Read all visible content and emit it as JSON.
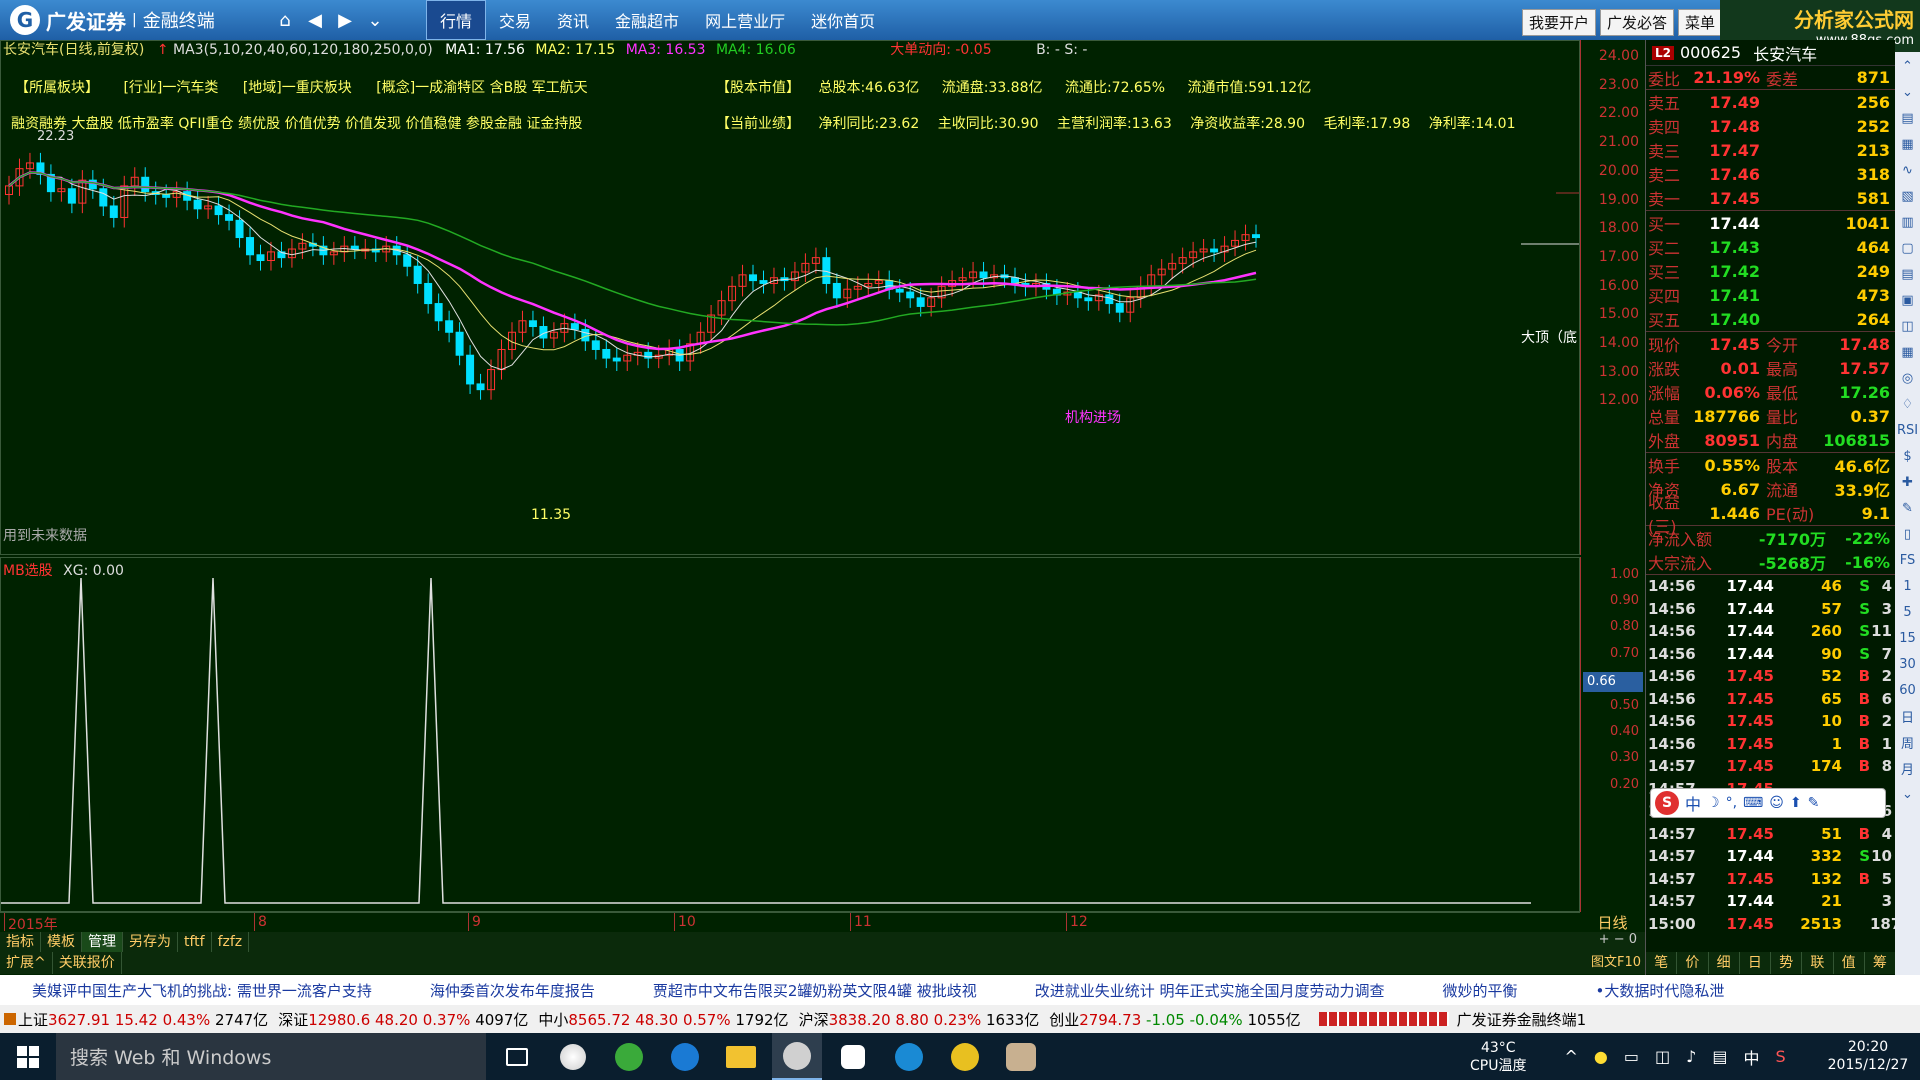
{
  "app": {
    "logo_text": "广发证券",
    "logo_sub": "金融终端",
    "menu": [
      "行情",
      "交易",
      "资讯",
      "金融超市",
      "网上营业厅",
      "迷你首页"
    ],
    "menu_active": 0,
    "right_buttons": [
      "我要开户",
      "广发必答",
      "菜单"
    ],
    "brand_title": "分析家公式网",
    "brand_url": "www.88gs.com"
  },
  "chart": {
    "title": "长安汽车(日线,前复权)",
    "ma_label": "MA3(5,10,20,40,60,120,180,250,0,0)",
    "ma1": "MA1: 17.56",
    "ma2": "MA2: 17.15",
    "ma3": "MA3: 16.53",
    "ma4": "MA4: 16.06",
    "dadan": "大单动向: -0.05",
    "bs": "B: -   S: -",
    "info_row1": [
      "【所属板块】",
      "[行业]一汽车类",
      "[地域]一重庆板块",
      "[概念]一成渝特区 含B股 军工航天"
    ],
    "info_right1": [
      "【股本市值】",
      "总股本:46.63亿",
      "流通盘:33.88亿",
      "流通比:72.65%",
      "流通市值:591.12亿"
    ],
    "info_row2": "融资融券 大盘股 低市盈率 QFII重仓 绩优股 价值优势 价值发现 价值稳健 参股金融 证金持股",
    "info_right2": [
      "【当前业绩】",
      "净利同比:23.62",
      "主收同比:30.90",
      "主营利润率:13.63",
      "净资收益率:28.90",
      "毛利率:17.98",
      "净利率:14.01"
    ],
    "future_note": "用到未来数据",
    "high_label": "22.23",
    "low_label": "11.35",
    "lowpt_label": "机构进场",
    "dading_label": "大顶（底",
    "price_ticks": [
      "24.00",
      "23.00",
      "22.00",
      "21.00",
      "20.00",
      "19.00",
      "18.00",
      "17.00",
      "16.00",
      "15.00",
      "14.00",
      "13.00",
      "12.00"
    ]
  },
  "indicator": {
    "name": "MB选股",
    "value": "XG: 0.00",
    "ticks": [
      "1.00",
      "0.90",
      "0.80",
      "0.70",
      "0.60",
      "0.50",
      "0.40",
      "0.30",
      "0.20"
    ],
    "xg_value": "0.66",
    "spikes_x": [
      80,
      212,
      430
    ]
  },
  "dates": [
    {
      "label": "2015年"
    },
    {
      "label": "8"
    },
    {
      "label": "9"
    },
    {
      "label": "10"
    },
    {
      "label": "11"
    },
    {
      "label": "12"
    }
  ],
  "period": "日线",
  "tabs1": [
    "指标",
    "模板",
    "管理",
    "另存为",
    "tftf",
    "fzfz"
  ],
  "tabs1_active": 2,
  "tabs2": [
    "扩展^",
    "关联报价"
  ],
  "f10": "图文F10",
  "quote": {
    "code": "000625",
    "name": "长安汽车",
    "weibi": {
      "label": "委比",
      "val": "21.19%",
      "label2": "委差",
      "val2": "871"
    },
    "sells": [
      {
        "label": "卖五",
        "price": "17.49",
        "vol": "256"
      },
      {
        "label": "卖四",
        "price": "17.48",
        "vol": "252"
      },
      {
        "label": "卖三",
        "price": "17.47",
        "vol": "213"
      },
      {
        "label": "卖二",
        "price": "17.46",
        "vol": "318"
      },
      {
        "label": "卖一",
        "price": "17.45",
        "vol": "581"
      }
    ],
    "buys": [
      {
        "label": "买一",
        "price": "17.44",
        "vol": "1041"
      },
      {
        "label": "买二",
        "price": "17.43",
        "vol": "464"
      },
      {
        "label": "买三",
        "price": "17.42",
        "vol": "249"
      },
      {
        "label": "买四",
        "price": "17.41",
        "vol": "473"
      },
      {
        "label": "买五",
        "price": "17.40",
        "vol": "264"
      }
    ],
    "stats": [
      [
        "现价",
        "17.45",
        "今开",
        "17.48"
      ],
      [
        "涨跌",
        "0.01",
        "最高",
        "17.57"
      ],
      [
        "涨幅",
        "0.06%",
        "最低",
        "17.26"
      ],
      [
        "总量",
        "187766",
        "量比",
        "0.37"
      ],
      [
        "外盘",
        "80951",
        "内盘",
        "106815"
      ]
    ],
    "stats2": [
      [
        "换手",
        "0.55%",
        "股本",
        "46.6亿"
      ],
      [
        "净资",
        "6.67",
        "流通",
        "33.9亿"
      ],
      [
        "收益(三)",
        "1.446",
        "PE(动)",
        "9.1"
      ]
    ],
    "flows": [
      [
        "净流入额",
        "-7170万",
        "-22%"
      ],
      [
        "大宗流入",
        "-5268万",
        "-16%"
      ]
    ],
    "ticks": [
      [
        "14:56",
        "17.44",
        "46",
        "S",
        "4"
      ],
      [
        "14:56",
        "17.44",
        "57",
        "S",
        "3"
      ],
      [
        "14:56",
        "17.44",
        "260",
        "S",
        "11"
      ],
      [
        "14:56",
        "17.44",
        "90",
        "S",
        "7"
      ],
      [
        "14:56",
        "17.45",
        "52",
        "B",
        "2"
      ],
      [
        "14:56",
        "17.45",
        "65",
        "B",
        "6"
      ],
      [
        "14:56",
        "17.45",
        "10",
        "B",
        "2"
      ],
      [
        "14:56",
        "17.45",
        "1",
        "B",
        "1"
      ],
      [
        "14:57",
        "17.45",
        "174",
        "B",
        "8"
      ],
      [
        "14:57",
        "17.45",
        "",
        "",
        ""
      ],
      [
        "14:57",
        "17.45",
        "268",
        "B",
        "6"
      ],
      [
        "14:57",
        "17.45",
        "51",
        "B",
        "4"
      ],
      [
        "14:57",
        "17.44",
        "332",
        "S",
        "10"
      ],
      [
        "14:57",
        "17.45",
        "132",
        "B",
        "5"
      ],
      [
        "14:57",
        "17.44",
        "21",
        "",
        "3"
      ],
      [
        "15:00",
        "17.45",
        "2513",
        "",
        "187"
      ]
    ],
    "panel_tabs": [
      "笔",
      "价",
      "细",
      "日",
      "势",
      "联",
      "值",
      "筹"
    ]
  },
  "news": [
    "美媒评中国生产大飞机的挑战: 需世界一流客户支持",
    "海仲委首次发布年度报告",
    "贾超市中文布告限买2罐奶粉英文限4罐 被批歧视",
    "改进就业失业统计 明年正式实施全国月度劳动力调查",
    "微妙的平衡",
    "•大数据时代隐私泄"
  ],
  "indices": {
    "sh": {
      "name": "上证",
      "val": "3627.91",
      "chg": "15.42",
      "pct": "0.43%",
      "amt": "2747亿"
    },
    "sz": {
      "name": "深证",
      "val": "12980.6",
      "chg": "48.20",
      "pct": "0.37%",
      "amt": "4097亿"
    },
    "zx": {
      "name": "中小",
      "val": "8565.72",
      "chg": "48.30",
      "pct": "0.57%",
      "amt": "1792亿"
    },
    "hs": {
      "name": "沪深",
      "val": "3838.20",
      "chg": "8.80",
      "pct": "0.23%",
      "amt": "1633亿"
    },
    "cy": {
      "name": "创业",
      "val": "2794.73",
      "chg": "-1.05",
      "pct": "-0.04%",
      "amt": "1055亿"
    },
    "app": "广发证券金融终端1"
  },
  "taskbar": {
    "search": "搜索 Web 和 Windows",
    "temp": "43°C",
    "temp_label": "CPU温度",
    "ime": "中",
    "time": "20:20",
    "date": "2015/12/27"
  },
  "colors": {
    "up": "#ff3333",
    "down": "#00e0ff",
    "ma_magenta": "#ff33ff",
    "ma_green": "#22aa22",
    "ma_yellow": "#e8e070",
    "ma_white": "#e0e0e0"
  }
}
